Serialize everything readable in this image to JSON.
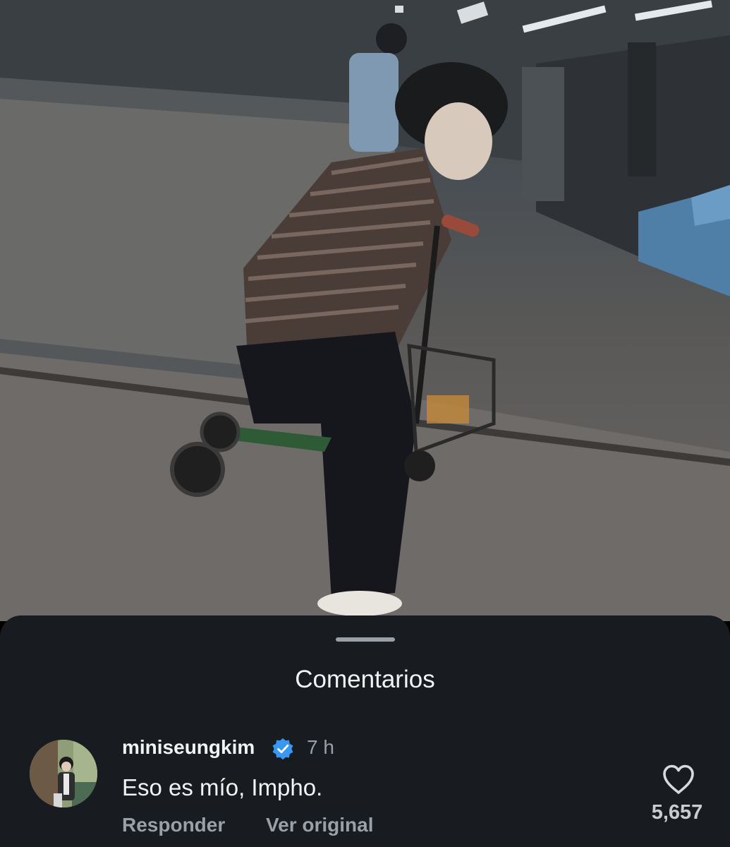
{
  "video": {
    "description_icon": "video-frame"
  },
  "sheet": {
    "title": "Comentarios"
  },
  "comment": {
    "username": "miniseungkim",
    "verified": true,
    "time": "7 h",
    "text": "Eso es mío, Impho.",
    "reply_label": "Responder",
    "original_label": "Ver original",
    "like_count": "5,657",
    "like_icon": "heart-outline-icon"
  },
  "colors": {
    "sheet_bg": "#181b1f",
    "verified_blue": "#3897f0",
    "muted_text": "#9aa0a6"
  }
}
